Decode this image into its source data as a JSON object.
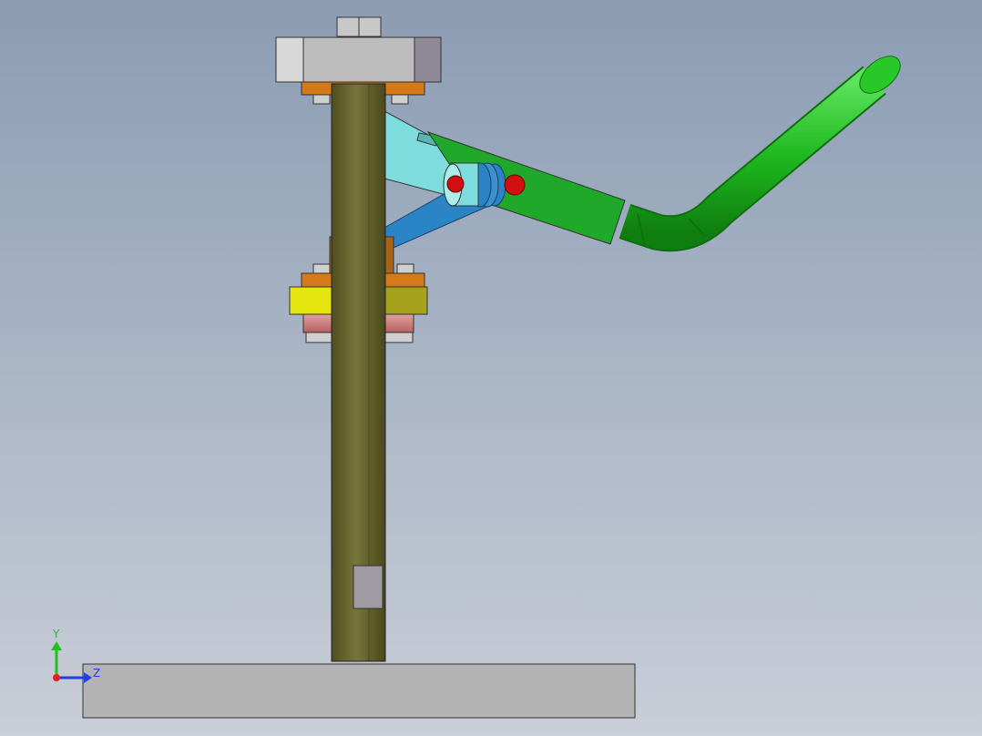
{
  "viewport": {
    "background_top": "#8b9cb3",
    "background_bottom": "#c9ced8"
  },
  "parts": {
    "post_color": "#6b6a30",
    "base_color": "#b3b3b3",
    "handle_color": "#1fb81f",
    "link_color": "#2a84c6",
    "link_light_color": "#7fdcdc",
    "clamp_block_color": "#e5e50f",
    "pin_color": "#d01010"
  },
  "triad": {
    "y_label": "Y",
    "z_label": "Z",
    "y_color": "#20c020",
    "z_color": "#2040e0",
    "x_color": "#e02020"
  }
}
